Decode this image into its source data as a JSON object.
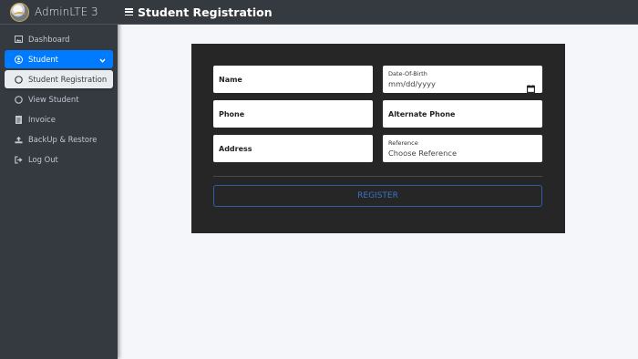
{
  "brand": {
    "name": "AdminLTE 3"
  },
  "header": {
    "title": "Student Registration"
  },
  "sidebar": {
    "items": [
      {
        "label": "Dashboard",
        "icon": "image-icon"
      },
      {
        "label": "Student",
        "icon": "user-circle-icon"
      },
      {
        "label": "Student Registration",
        "icon": "circle-icon"
      },
      {
        "label": "View Student",
        "icon": "circle-icon"
      },
      {
        "label": "Invoice",
        "icon": "file-icon"
      },
      {
        "label": "BackUp & Restore",
        "icon": "upload-icon"
      },
      {
        "label": "Log Out",
        "icon": "sign-out-icon"
      }
    ]
  },
  "form": {
    "name_label": "Name",
    "dob_label": "Date-Of-Birth",
    "dob_placeholder": "mm/dd/yyyy",
    "phone_label": "Phone",
    "alt_phone_label": "Alternate Phone",
    "address_label": "Address",
    "reference_label": "Reference",
    "reference_value": "Choose Reference",
    "register_label": "REGISTER"
  },
  "colors": {
    "sidebar_bg": "#343a40",
    "active": "#007bff",
    "card_bg": "#262626",
    "content_bg": "#f4f6f9",
    "button_border": "#2f5fa8"
  }
}
